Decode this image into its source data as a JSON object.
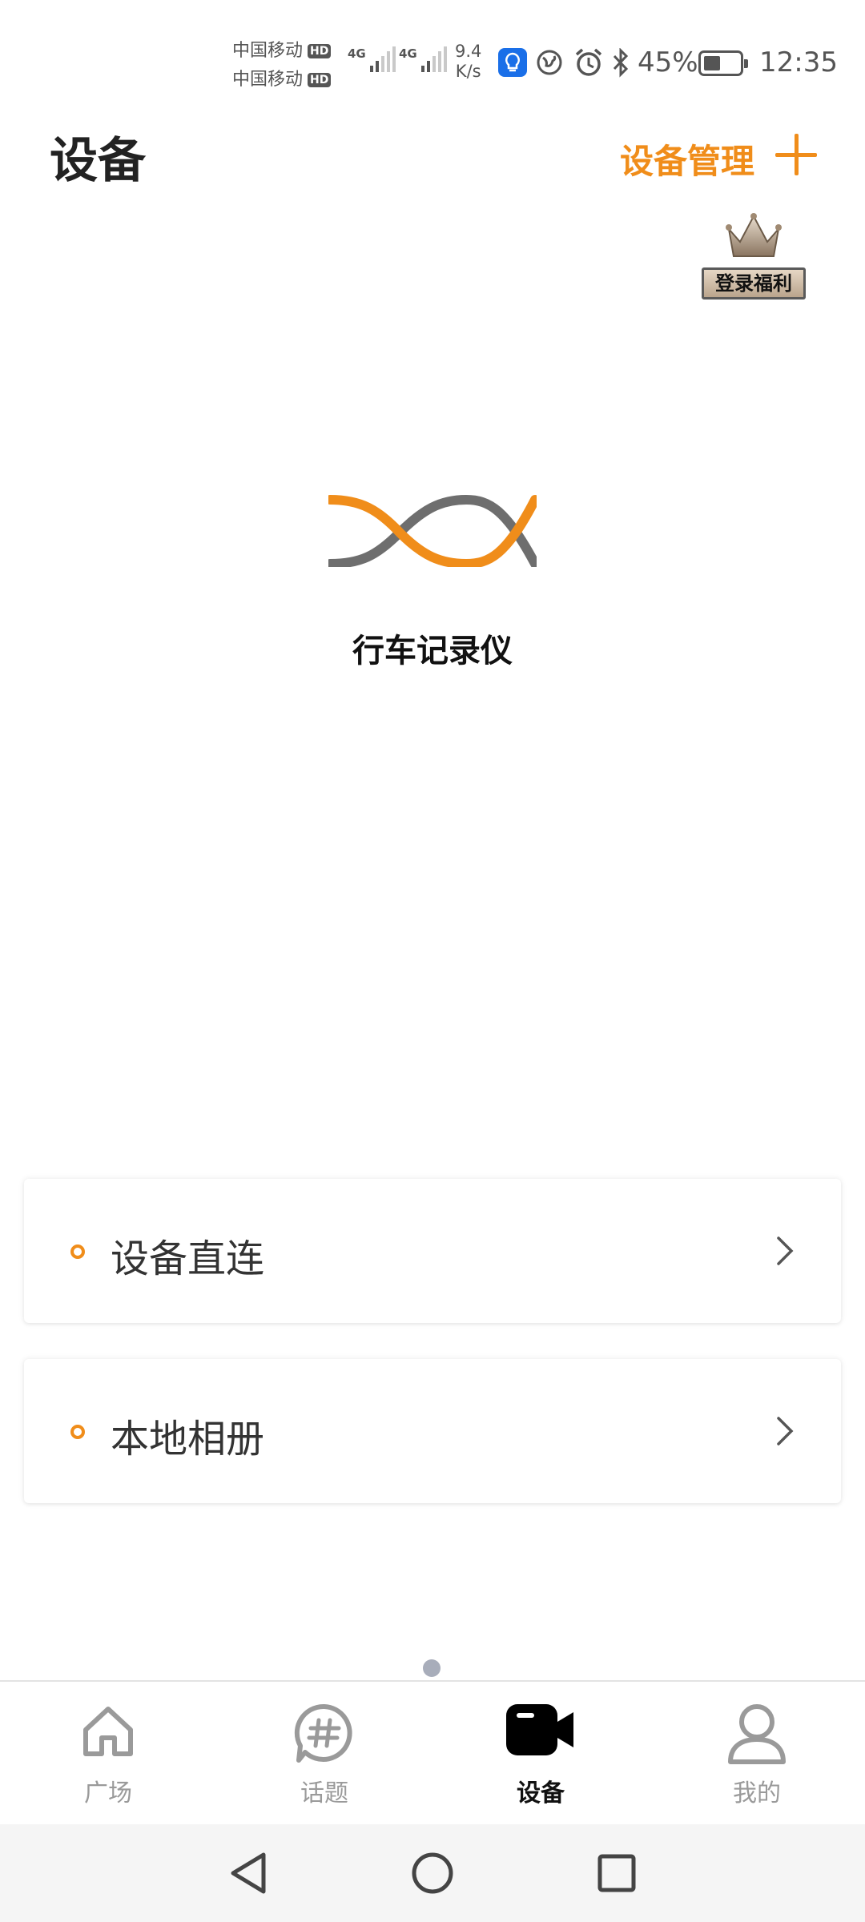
{
  "status_bar": {
    "carrier_1": "中国移动",
    "carrier_2": "中国移动",
    "hd_badge": "HD",
    "network_type": "4G",
    "net_speed_value": "9.4",
    "net_speed_unit": "K/s",
    "battery_percent": "45%",
    "battery_level": 0.45,
    "time": "12:35"
  },
  "header": {
    "title": "设备",
    "manage_label": "设备管理"
  },
  "login_benefit": {
    "label": "登录福利"
  },
  "device": {
    "name": "行车记录仪"
  },
  "list": {
    "items": [
      {
        "label": "设备直连"
      },
      {
        "label": "本地相册"
      }
    ]
  },
  "bottom_nav": {
    "items": [
      {
        "label": "广场",
        "icon": "home-icon",
        "active": false
      },
      {
        "label": "话题",
        "icon": "hashtag-icon",
        "active": false
      },
      {
        "label": "设备",
        "icon": "camera-icon",
        "active": true
      },
      {
        "label": "我的",
        "icon": "person-icon",
        "active": false
      }
    ]
  },
  "colors": {
    "accent": "#f08d1a",
    "logo_gray": "#6e6e6e",
    "text_primary": "#222222",
    "nav_inactive": "#9a9a9a"
  }
}
